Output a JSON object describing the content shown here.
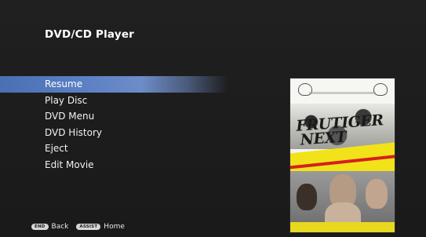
{
  "header": {
    "title": "DVD/CD Player"
  },
  "menu": {
    "items": [
      {
        "label": "Resume",
        "selected": true
      },
      {
        "label": "Play Disc",
        "selected": false
      },
      {
        "label": "DVD Menu",
        "selected": false
      },
      {
        "label": "DVD History",
        "selected": false
      },
      {
        "label": "Eject",
        "selected": false
      },
      {
        "label": "Edit Movie",
        "selected": false
      }
    ]
  },
  "footer": {
    "back_key": "END",
    "back_label": "Back",
    "home_key": "ASSIST",
    "home_label": "Home"
  },
  "poster": {
    "title_line1": "FRUTIGER",
    "title_line2": "NEXT"
  },
  "colors": {
    "background": "#1e1e1e",
    "selection": "#5a7fc4",
    "poster_yellow": "#f2e21a",
    "poster_red": "#d42020"
  }
}
